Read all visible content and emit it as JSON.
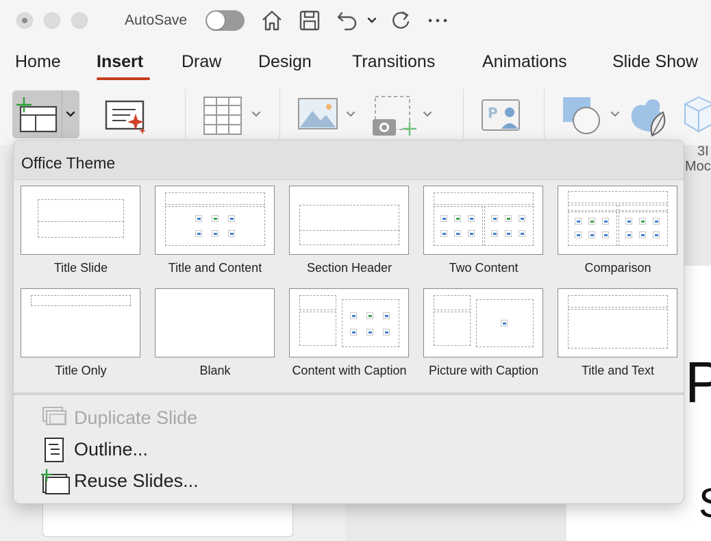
{
  "titlebar": {
    "autosave_label": "AutoSave",
    "autosave_on": false
  },
  "tabs": [
    {
      "label": "Home"
    },
    {
      "label": "Insert",
      "active": true
    },
    {
      "label": "Draw"
    },
    {
      "label": "Design"
    },
    {
      "label": "Transitions"
    },
    {
      "label": "Animations"
    },
    {
      "label": "Slide Show"
    }
  ],
  "ribbon": {
    "partial_label_line1": "3I",
    "partial_label_line2": "Moc"
  },
  "slide_preview": {
    "glyph_1": "P",
    "glyph_2": "S"
  },
  "menu": {
    "section_title": "Office Theme",
    "layouts": [
      {
        "label": "Title Slide"
      },
      {
        "label": "Title and Content"
      },
      {
        "label": "Section Header"
      },
      {
        "label": "Two Content"
      },
      {
        "label": "Comparison"
      },
      {
        "label": "Title Only"
      },
      {
        "label": "Blank"
      },
      {
        "label": "Content with Caption"
      },
      {
        "label": "Picture with Caption"
      },
      {
        "label": "Title and Text"
      }
    ],
    "items": [
      {
        "label": "Duplicate Slide",
        "enabled": false
      },
      {
        "label": "Outline...",
        "enabled": true
      },
      {
        "label": "Reuse Slides...",
        "enabled": true
      }
    ]
  },
  "colors": {
    "accent_underline": "#c43e1c",
    "new_icon_green": "#2e9e3e",
    "ribbon_blue": "#4a8cc9"
  }
}
